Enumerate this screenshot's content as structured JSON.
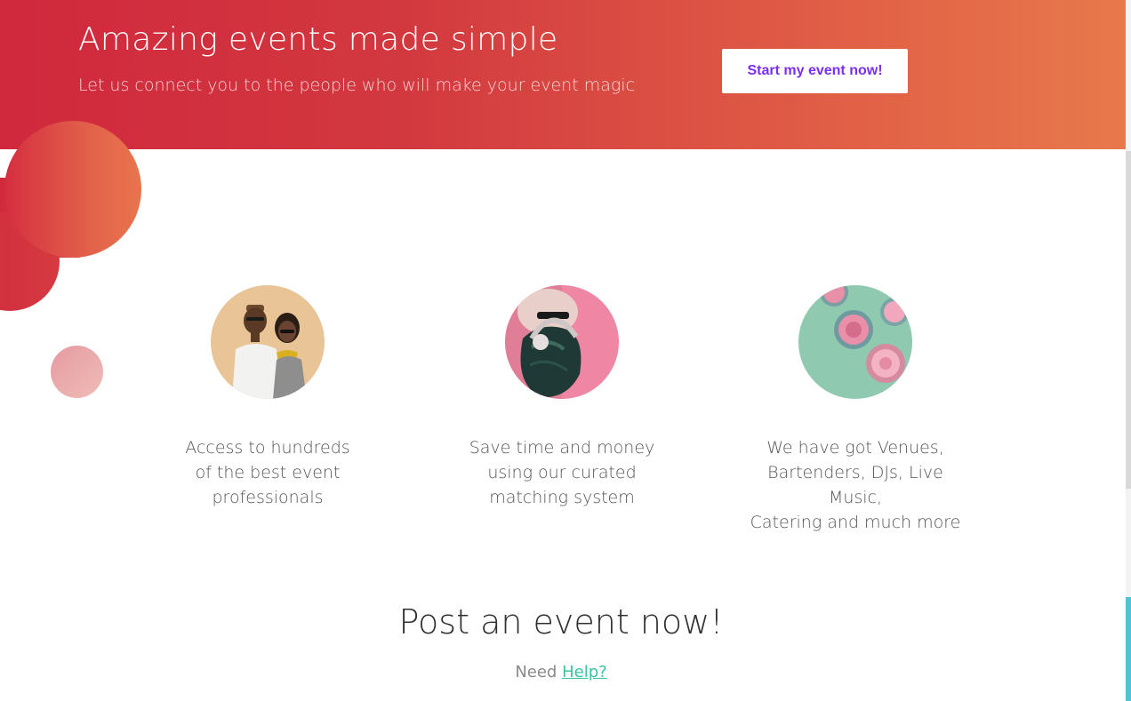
{
  "hero": {
    "title": "Amazing events made simple",
    "subtitle": "Let us connect you to the people who will make your event magic",
    "cta_label": "Start my event now!",
    "colors": {
      "gradient_start": "#d0283d",
      "gradient_end": "#e8794b",
      "cta_text": "#7a2ff0"
    }
  },
  "features": [
    {
      "image": "couple-with-headphones-photo",
      "text": "Access to hundreds\nof the best event\nprofessionals"
    },
    {
      "image": "woman-with-headphones-photo",
      "text": "Save time and money\nusing our curated\nmatching system"
    },
    {
      "image": "donuts-on-mint-photo",
      "text": "We have got Venues,\nBartenders, DJs, Live Music,\nCatering and much more"
    }
  ],
  "post_section": {
    "title": "Post an event now!",
    "help_prefix": "Need",
    "help_link": "Help?",
    "link_color": "#39c3a2"
  }
}
